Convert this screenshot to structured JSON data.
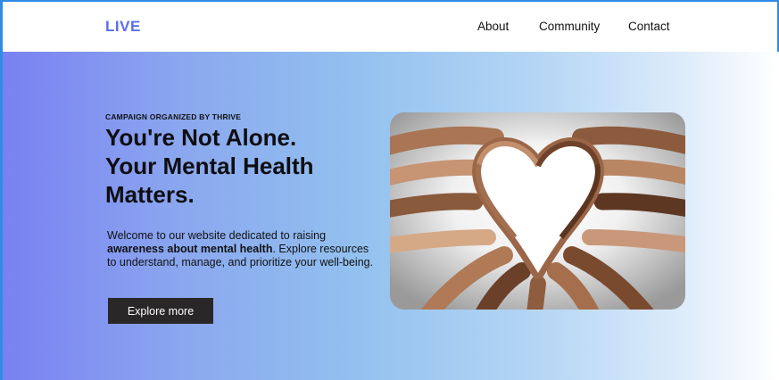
{
  "brand": {
    "logo": "LIVE",
    "accent": "#5b6ef0"
  },
  "nav": {
    "links": [
      {
        "label": "About"
      },
      {
        "label": "Community"
      },
      {
        "label": "Contact"
      }
    ]
  },
  "hero": {
    "kicker": "CAMPAIGN ORGANIZED BY THRIVE",
    "headline": [
      "You're Not Alone.",
      "Your Mental Health",
      "Matters."
    ],
    "description": {
      "line1": "Welcome to our website dedicated to raising",
      "bold": "awareness about mental health",
      "line2_rest": ". Explore resources",
      "line3": "to understand, manage, and prioritize your well-being."
    },
    "cta_label": "Explore more",
    "image_alt": "hands forming a heart",
    "gradient": [
      "#7a80f2",
      "#92c0ef",
      "#ffffff"
    ]
  }
}
